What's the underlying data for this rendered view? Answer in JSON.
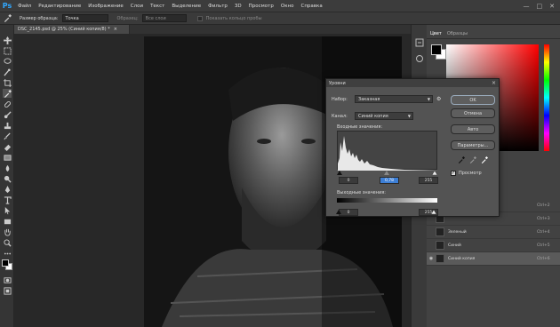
{
  "app": {
    "logo": "Ps"
  },
  "menu": [
    "Файл",
    "Редактирование",
    "Изображение",
    "Слои",
    "Текст",
    "Выделение",
    "Фильтр",
    "3D",
    "Просмотр",
    "Окно",
    "Справка"
  ],
  "window_controls": [
    "—",
    "□",
    "✕"
  ],
  "options": {
    "sample_label": "Размер образца:",
    "sample_value": "Точка",
    "samples_label": "Образец:",
    "samples_value": "Все слои",
    "show_ring": "Показать кольцо пробы"
  },
  "document": {
    "tab_title": "DSC_2145.psd @ 25% (Синий копия/8) *"
  },
  "color_panel": {
    "tabs": [
      "Цвет",
      "Образцы"
    ],
    "fg_color": "#000000",
    "bg_color": "#ffffff"
  },
  "layers": [
    {
      "name": "",
      "shortcut": "Ctrl+2",
      "selected": false
    },
    {
      "name": "",
      "shortcut": "Ctrl+3",
      "selected": false
    },
    {
      "name": "Зеленый",
      "shortcut": "Ctrl+4",
      "selected": false
    },
    {
      "name": "Синий",
      "shortcut": "Ctrl+5",
      "selected": false
    },
    {
      "name": "Синий копия",
      "shortcut": "Ctrl+6",
      "selected": true
    }
  ],
  "levels_dialog": {
    "title": "Уровни",
    "preset_label": "Набор:",
    "preset_value": "Заказная",
    "channel_label": "Канал:",
    "channel_value": "Синий копия",
    "input_label": "Входные значения:",
    "output_label": "Выходные значения:",
    "input_black": "0",
    "input_gamma": "0,78",
    "input_white": "255",
    "output_black": "0",
    "output_white": "255",
    "ok": "OK",
    "cancel": "Отмена",
    "auto": "Авто",
    "options": "Параметры...",
    "preview_label": "Просмотр",
    "preview_checked": true
  }
}
